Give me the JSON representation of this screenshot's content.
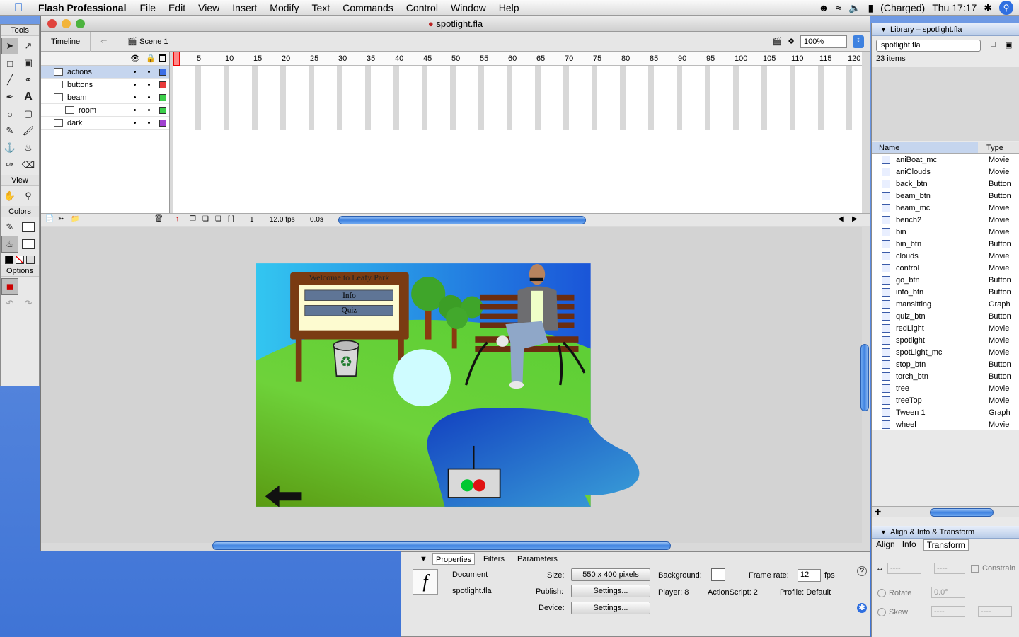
{
  "menubar": {
    "app_name": "Flash Professional",
    "items": [
      "File",
      "Edit",
      "View",
      "Insert",
      "Modify",
      "Text",
      "Commands",
      "Control",
      "Window",
      "Help"
    ],
    "battery": "(Charged)",
    "clock": "Thu 17:17"
  },
  "tools": {
    "title": "Tools",
    "view_label": "View",
    "colors_label": "Colors",
    "options_label": "Options"
  },
  "window": {
    "title": "spotlight.fla"
  },
  "timeline": {
    "tab": "Timeline",
    "scene": "Scene 1",
    "zoom": "100%",
    "layers": [
      {
        "name": "actions",
        "color": "#3c6ee6"
      },
      {
        "name": "buttons",
        "color": "#e83a3a"
      },
      {
        "name": "beam",
        "color": "#3ccf4a"
      },
      {
        "name": "room",
        "color": "#3ccf4a"
      },
      {
        "name": "dark",
        "color": "#a040d0"
      }
    ],
    "ruler": [
      "1",
      "5",
      "10",
      "15",
      "20",
      "25",
      "30",
      "35",
      "40",
      "45",
      "50",
      "55",
      "60",
      "65",
      "70",
      "75",
      "80",
      "85",
      "90",
      "95",
      "100",
      "105",
      "110",
      "115",
      "120"
    ],
    "frame": "1",
    "fps": "12.0 fps",
    "time": "0.0s"
  },
  "stage": {
    "sign_title": "Welcome to Leafy Park",
    "btn_info": "Info",
    "btn_quiz": "Quiz"
  },
  "library": {
    "title": "Library – spotlight.fla",
    "dropdown": "spotlight.fla",
    "count": "23 items",
    "col_name": "Name",
    "col_type": "Type",
    "items": [
      {
        "name": "aniBoat_mc",
        "type": "Movie"
      },
      {
        "name": "aniClouds",
        "type": "Movie"
      },
      {
        "name": "back_btn",
        "type": "Button"
      },
      {
        "name": "beam_btn",
        "type": "Button"
      },
      {
        "name": "beam_mc",
        "type": "Movie"
      },
      {
        "name": "bench2",
        "type": "Movie"
      },
      {
        "name": "bin",
        "type": "Movie"
      },
      {
        "name": "bin_btn",
        "type": "Button"
      },
      {
        "name": "clouds",
        "type": "Movie"
      },
      {
        "name": "control",
        "type": "Movie"
      },
      {
        "name": "go_btn",
        "type": "Button"
      },
      {
        "name": "info_btn",
        "type": "Button"
      },
      {
        "name": "mansitting",
        "type": "Graph"
      },
      {
        "name": "quiz_btn",
        "type": "Button"
      },
      {
        "name": "redLight",
        "type": "Movie"
      },
      {
        "name": "spotlight",
        "type": "Movie"
      },
      {
        "name": "spotLight_mc",
        "type": "Movie"
      },
      {
        "name": "stop_btn",
        "type": "Button"
      },
      {
        "name": "torch_btn",
        "type": "Button"
      },
      {
        "name": "tree",
        "type": "Movie"
      },
      {
        "name": "treeTop",
        "type": "Movie"
      },
      {
        "name": "Tween 1",
        "type": "Graph"
      },
      {
        "name": "wheel",
        "type": "Movie"
      }
    ]
  },
  "transform": {
    "title": "Align & Info & Transform",
    "tabs": [
      "Align",
      "Info",
      "Transform"
    ],
    "dash": "----",
    "constrain": "Constrain",
    "rotate": "Rotate",
    "rotate_val": "0.0°",
    "skew": "Skew"
  },
  "properties": {
    "tabs": [
      "Properties",
      "Filters",
      "Parameters"
    ],
    "doc_label": "Document",
    "doc_name": "spotlight.fla",
    "size_label": "Size:",
    "size_value": "550 x 400 pixels",
    "background_label": "Background:",
    "framerate_label": "Frame rate:",
    "framerate_value": "12",
    "fps_label": "fps",
    "publish_label": "Publish:",
    "settings": "Settings...",
    "player": "Player: 8",
    "actionscript": "ActionScript: 2",
    "profile": "Profile:  Default",
    "device_label": "Device:"
  }
}
